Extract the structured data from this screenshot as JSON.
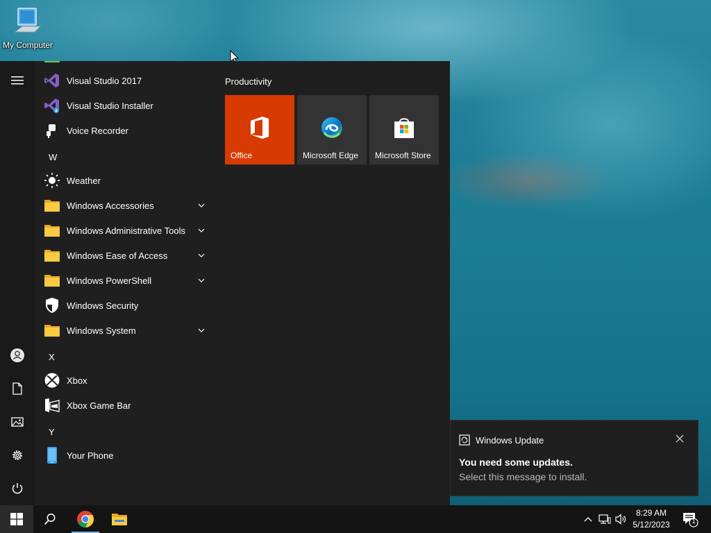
{
  "desktop": {
    "icons": [
      {
        "label": "My Computer",
        "icon": "computer-icon"
      }
    ]
  },
  "start_menu": {
    "rail": [
      {
        "name": "expand",
        "icon": "hamburger-icon"
      },
      {
        "name": "account",
        "icon": "user-icon"
      },
      {
        "name": "documents",
        "icon": "document-icon"
      },
      {
        "name": "pictures",
        "icon": "pictures-icon"
      },
      {
        "name": "settings",
        "icon": "gear-icon"
      },
      {
        "name": "power",
        "icon": "power-icon"
      }
    ],
    "apps": [
      {
        "label": "Visual Studio 2017",
        "icon": "visual-studio-icon"
      },
      {
        "label": "Visual Studio Installer",
        "icon": "visual-studio-installer-icon"
      },
      {
        "label": "Voice Recorder",
        "icon": "microphone-icon"
      },
      {
        "letter": "W"
      },
      {
        "label": "Weather",
        "icon": "sun-icon"
      },
      {
        "label": "Windows Accessories",
        "icon": "folder-icon",
        "expandable": true
      },
      {
        "label": "Windows Administrative Tools",
        "icon": "folder-icon",
        "expandable": true
      },
      {
        "label": "Windows Ease of Access",
        "icon": "folder-icon",
        "expandable": true
      },
      {
        "label": "Windows PowerShell",
        "icon": "folder-icon",
        "expandable": true
      },
      {
        "label": "Windows Security",
        "icon": "shield-icon"
      },
      {
        "label": "Windows System",
        "icon": "folder-icon",
        "expandable": true
      },
      {
        "letter": "X"
      },
      {
        "label": "Xbox",
        "icon": "xbox-icon"
      },
      {
        "label": "Xbox Game Bar",
        "icon": "game-bar-icon"
      },
      {
        "letter": "Y"
      },
      {
        "label": "Your Phone",
        "icon": "phone-icon"
      }
    ],
    "group_title": "Productivity",
    "tiles": [
      {
        "label": "Office",
        "icon": "office-icon",
        "color": "#d83b01"
      },
      {
        "label": "Microsoft Edge",
        "icon": "edge-icon",
        "color": "#333333"
      },
      {
        "label": "Microsoft Store",
        "icon": "store-icon",
        "color": "#333333"
      }
    ]
  },
  "notification": {
    "app": "Windows Update",
    "title": "You need some updates.",
    "body": "Select this message to install."
  },
  "taskbar": {
    "pinned": [
      {
        "name": "start",
        "icon": "windows-logo-icon"
      },
      {
        "name": "search",
        "icon": "search-icon"
      },
      {
        "name": "chrome",
        "icon": "chrome-icon"
      },
      {
        "name": "file-explorer",
        "icon": "folder-icon"
      }
    ],
    "tray": [
      {
        "name": "show-hidden",
        "icon": "chevron-up-icon"
      },
      {
        "name": "network",
        "icon": "network-icon"
      },
      {
        "name": "volume",
        "icon": "speaker-icon"
      }
    ],
    "time": "8:29 AM",
    "date": "5/12/2023",
    "notifications_count": "1"
  }
}
